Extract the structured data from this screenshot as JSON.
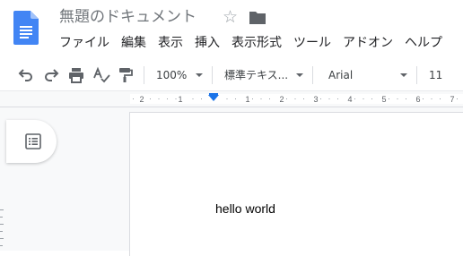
{
  "document": {
    "title": "無題のドキュメント",
    "body_text": "hello world"
  },
  "menu": {
    "items": [
      {
        "label": "ファイル"
      },
      {
        "label": "編集"
      },
      {
        "label": "表示"
      },
      {
        "label": "挿入"
      },
      {
        "label": "表示形式"
      },
      {
        "label": "ツール"
      },
      {
        "label": "アドオン"
      },
      {
        "label": "ヘルプ"
      }
    ]
  },
  "toolbar": {
    "zoom": "100%",
    "paragraph_style": "標準テキス...",
    "font": "Arial",
    "font_size": "11"
  },
  "ruler": {
    "labels": [
      "2",
      "1",
      "1",
      "2",
      "3",
      "4",
      "5",
      "6",
      "7"
    ]
  },
  "icons": {
    "doc_logo": "google-docs-icon",
    "star": "star-icon",
    "folder": "folder-icon",
    "undo": "undo-icon",
    "redo": "redo-icon",
    "print": "print-icon",
    "spellcheck": "spellcheck-icon",
    "paint_format": "paint-format-icon",
    "outline": "document-outline-icon"
  },
  "colors": {
    "doc_blue": "#4285f4",
    "ruler_marker": "#1a73e8",
    "title_gray": "#70757a"
  }
}
